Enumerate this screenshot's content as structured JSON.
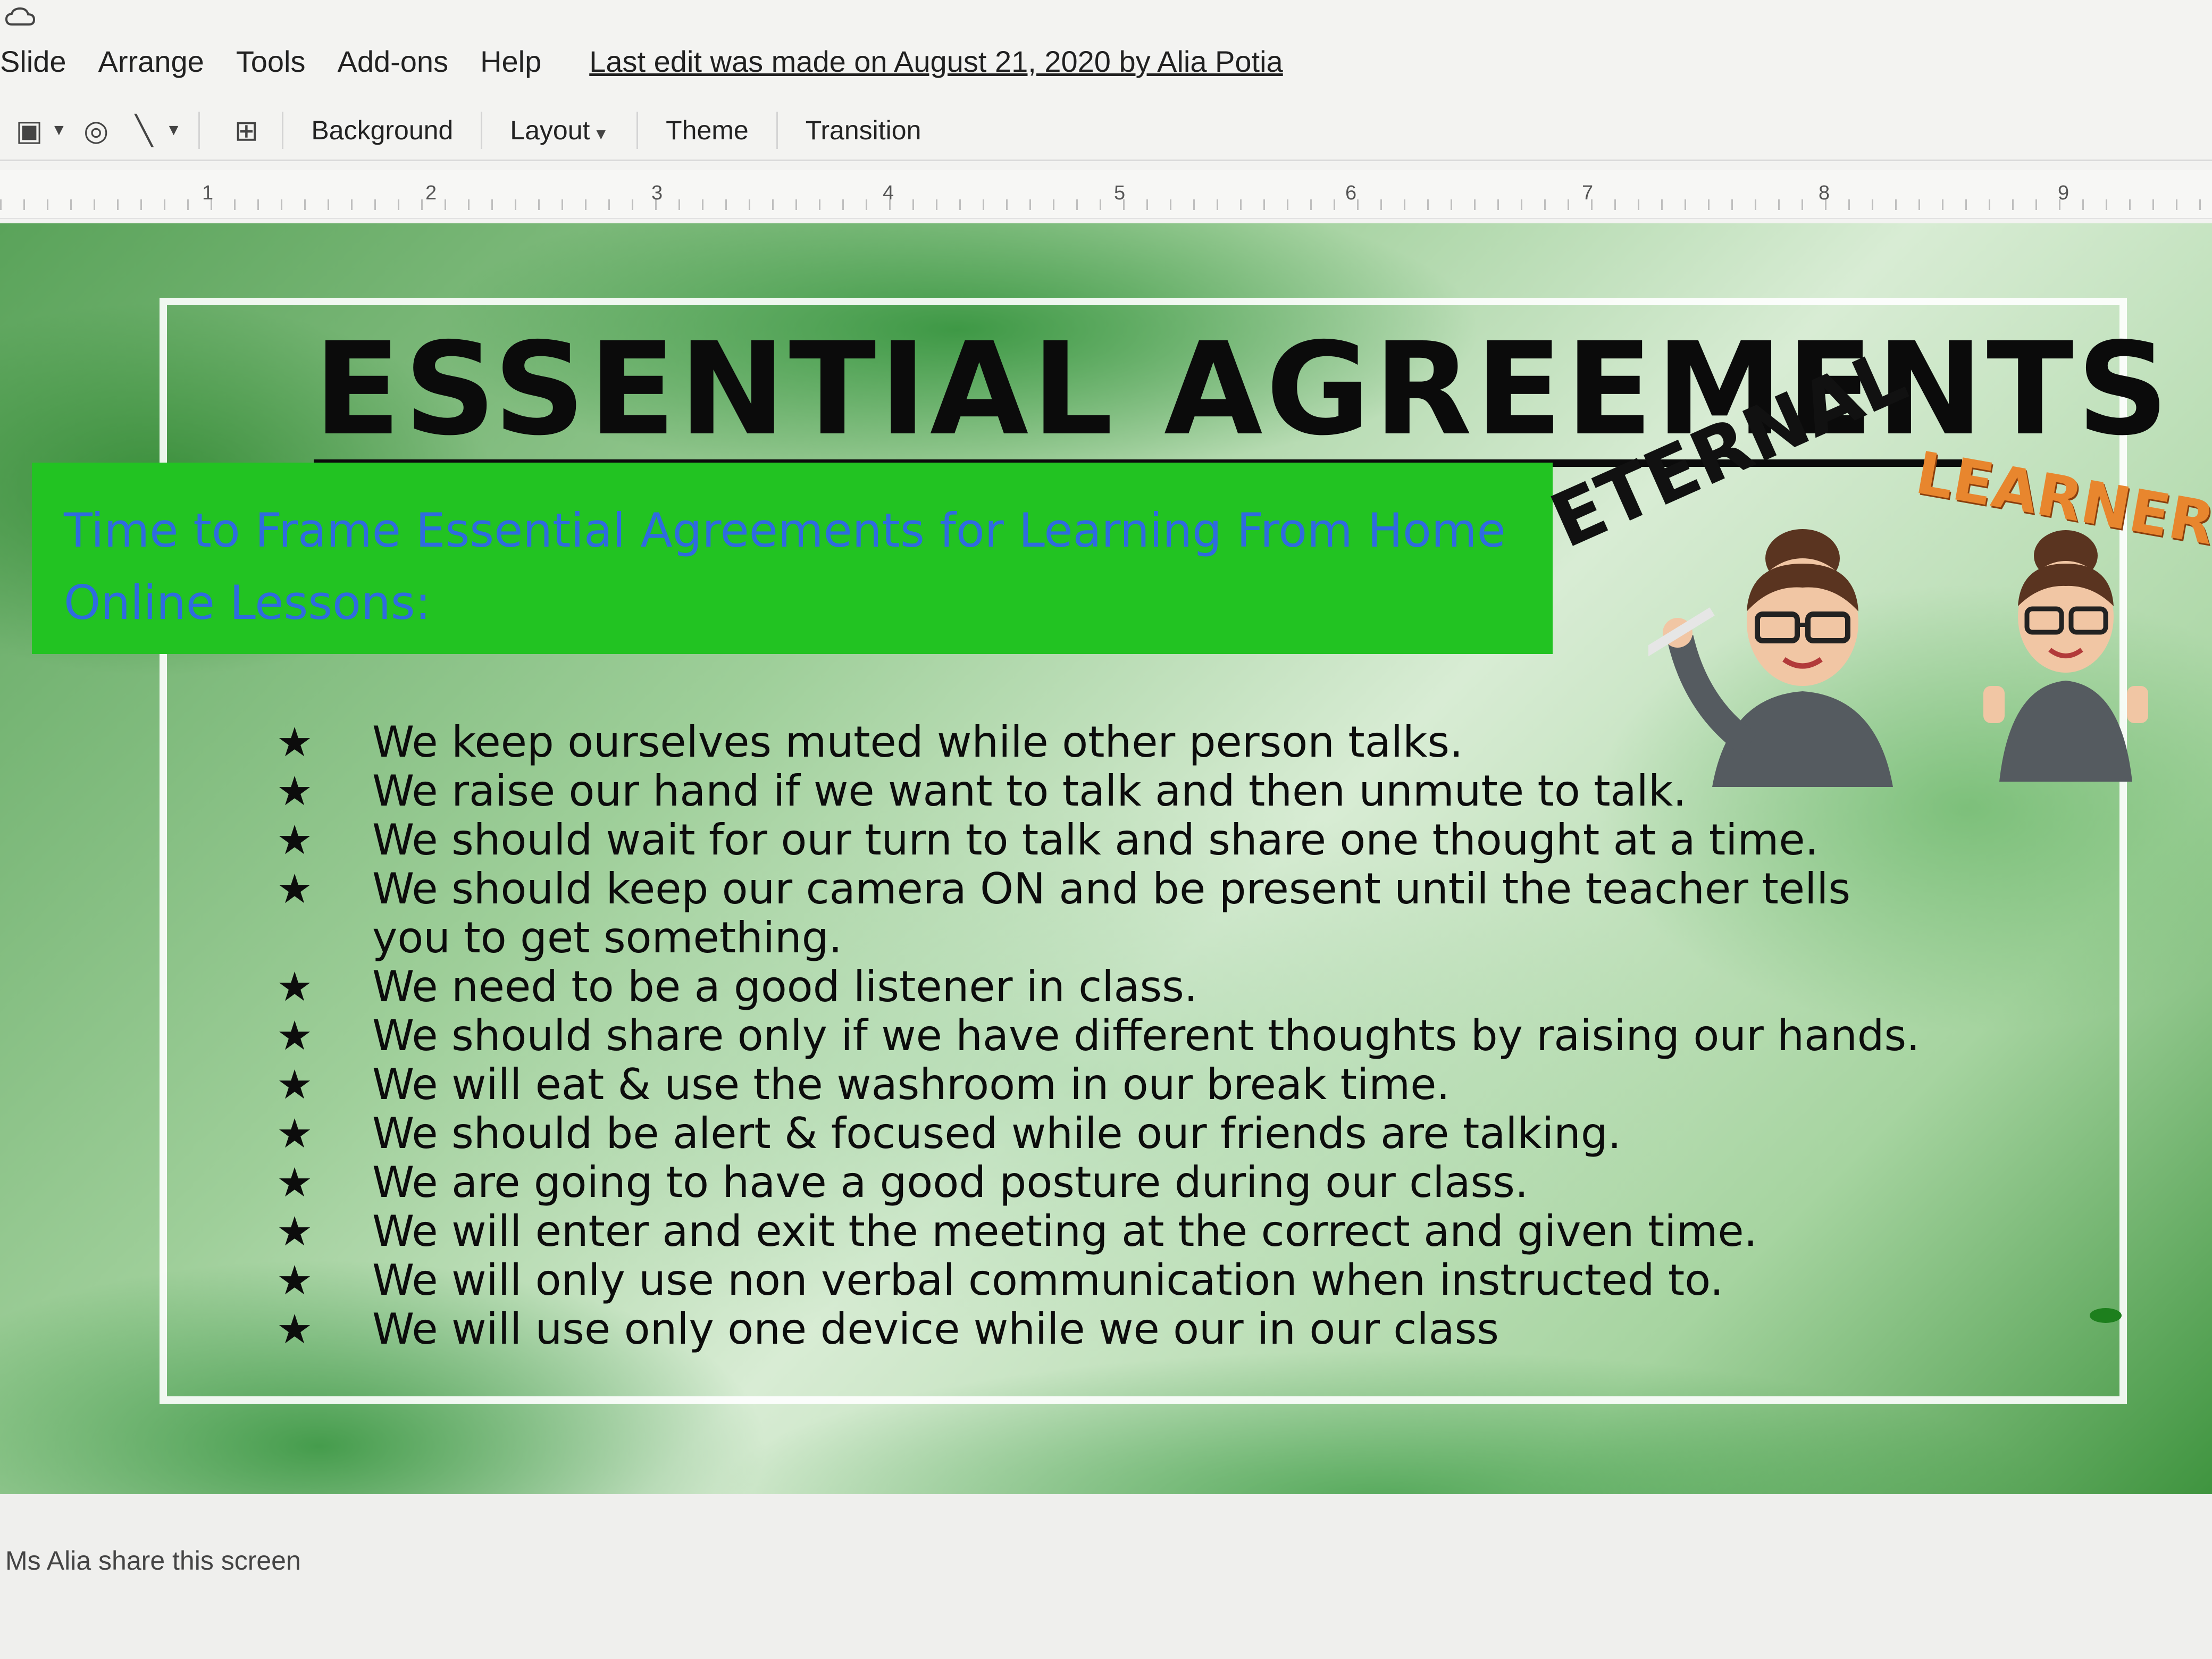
{
  "menu": {
    "items": [
      "Slide",
      "Arrange",
      "Tools",
      "Add-ons",
      "Help"
    ],
    "last_edit": "Last edit was made on August 21, 2020 by Alia Potia"
  },
  "toolbar": {
    "background": "Background",
    "layout": "Layout",
    "theme": "Theme",
    "transition": "Transition"
  },
  "ruler": {
    "marks": [
      "1",
      "2",
      "3",
      "4",
      "5",
      "6",
      "7",
      "8",
      "9"
    ]
  },
  "slide": {
    "title": "ESSENTIAL AGREEMENTS",
    "subtitle_line1": "Time to Frame Essential Agreements for Learning From Home",
    "subtitle_line2": "Online Lessons:",
    "eternal": "ETERNAL",
    "learners": "LEARNERS",
    "agreements": [
      "We keep ourselves muted while other person talks.",
      "We raise our hand if we want to talk and then unmute to talk.",
      "We should wait for our turn to talk and share one thought at a time.",
      "We should keep our camera ON and be present until the teacher tells you to get something.",
      "We need to be a good listener in class.",
      "We should share only if we have different thoughts by raising our hands.",
      "We will eat & use the washroom in our break time.",
      "We should be alert & focused while our friends are talking.",
      "We are going to have a good posture during our class.",
      "We will enter and exit the meeting at the correct and given time.",
      "We will only use non verbal communication when instructed to.",
      "We will use only one device while we our in our class"
    ]
  },
  "status": {
    "share_text": "Ms Alia share this screen"
  },
  "colors": {
    "subtitle_box": "#22c322",
    "subtitle_text": "#2f6be0",
    "learners_text": "#e8862e"
  }
}
